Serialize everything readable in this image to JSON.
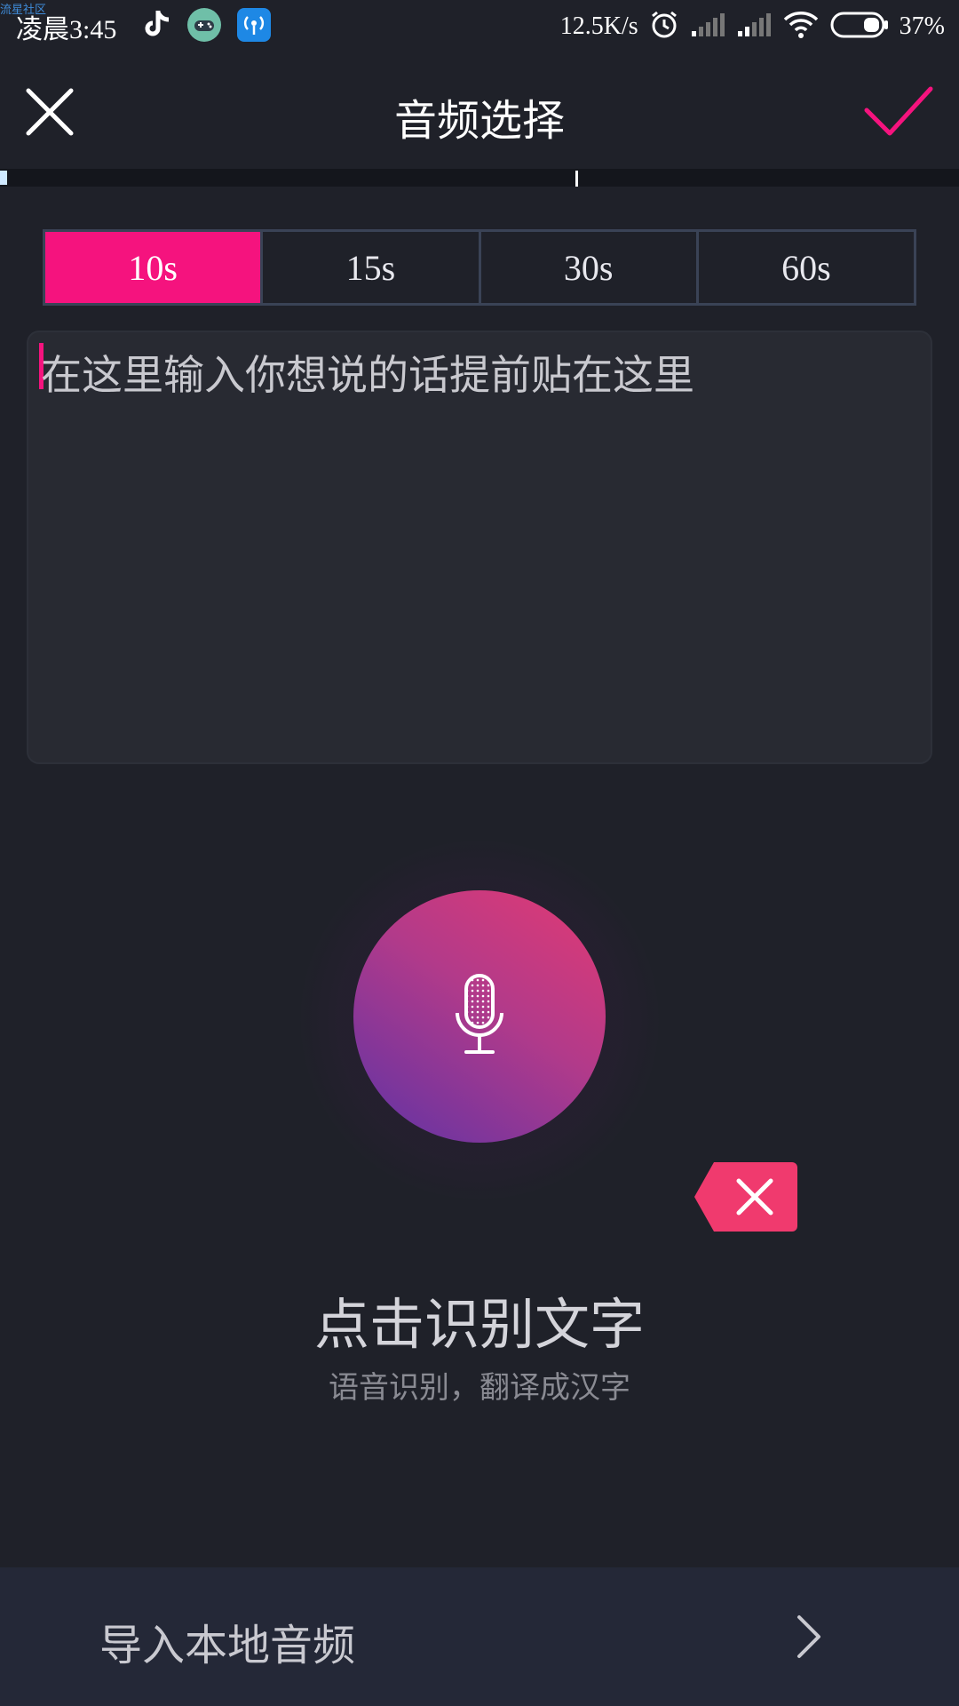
{
  "status_bar": {
    "watermark": "流星社区",
    "time": "凌晨3:45",
    "net_speed": "12.5K/s",
    "battery": "37%",
    "app_icons": [
      "tiktok-icon",
      "game-controller-icon",
      "wifi-hotspot-app-icon"
    ],
    "indicators": [
      "alarm-icon",
      "signal-icon",
      "signal-icon",
      "wifi-icon",
      "battery-icon"
    ]
  },
  "header": {
    "title": "音频选择",
    "close_icon": "close-icon",
    "confirm_icon": "checkmark-icon"
  },
  "duration_tabs": [
    {
      "label": "10s",
      "active": true
    },
    {
      "label": "15s",
      "active": false
    },
    {
      "label": "30s",
      "active": false
    },
    {
      "label": "60s",
      "active": false
    }
  ],
  "text_input": {
    "placeholder": "在这里输入你想说的话提前贴在这里"
  },
  "mic": {
    "icon": "microphone-icon",
    "delete_icon": "close-icon"
  },
  "hint": {
    "title": "点击识别文字",
    "subtitle": "语音识别，翻译成汉字"
  },
  "bottom": {
    "import_label": "导入本地音频",
    "chevron_icon": "chevron-right-icon"
  },
  "colors": {
    "accent": "#f5137e",
    "background": "#1f2129",
    "input_bg": "#282a32",
    "bottom_bar": "#242837"
  }
}
